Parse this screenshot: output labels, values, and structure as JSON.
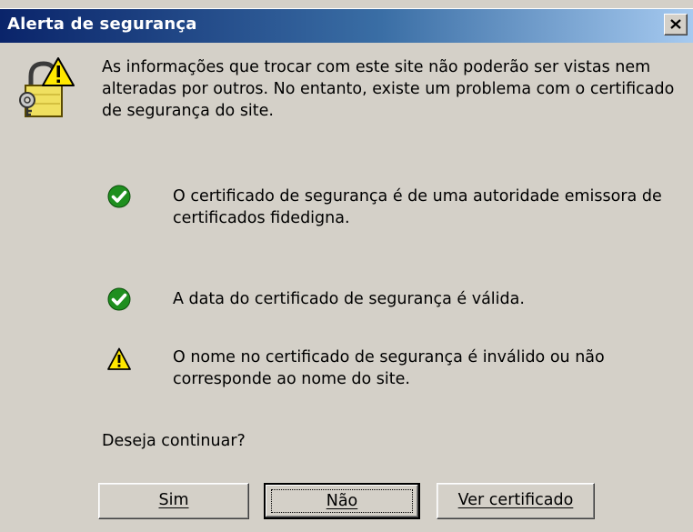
{
  "window": {
    "title": "Alerta de segurança",
    "close_icon": "close-icon"
  },
  "intro": {
    "icon": "security-lock-warning-icon",
    "text": "As informações que trocar com este site não poderão ser vistas nem alteradas por outros. No entanto, existe um problema com o certificado de segurança do site."
  },
  "items": [
    {
      "status": "ok",
      "icon": "green-check-icon",
      "text": "O certificado de segurança é de uma autoridade emissora de certificados fidedigna."
    },
    {
      "status": "ok",
      "icon": "green-check-icon",
      "text": "A data do certificado de segurança é válida."
    },
    {
      "status": "warning",
      "icon": "warning-triangle-icon",
      "text": "O nome no certificado de segurança é inválido ou não corresponde ao nome do site."
    }
  ],
  "question": "Deseja continuar?",
  "buttons": {
    "yes": "Sim",
    "no": "Não",
    "view_certificate": "Ver certificado"
  },
  "colors": {
    "titlebar_start": "#0a246a",
    "titlebar_end": "#a6caf0",
    "dialog_face": "#d4d0c8",
    "check_green": "#1f8f1f",
    "warning_yellow": "#ffe800"
  }
}
